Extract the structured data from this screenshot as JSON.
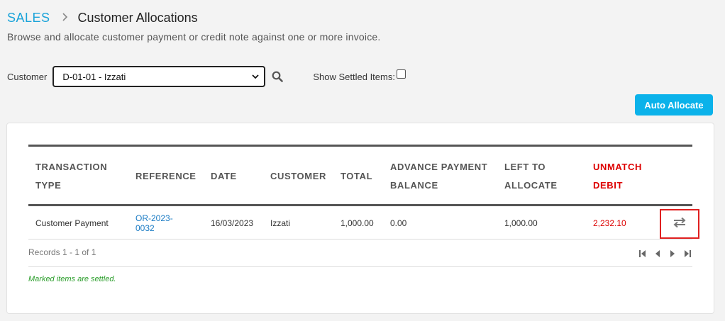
{
  "breadcrumb": {
    "section": "SALES",
    "separator": ">",
    "current": "Customer Allocations"
  },
  "subtitle": "Browse and allocate customer payment or credit note against one or more invoice.",
  "filters": {
    "customer_label": "Customer",
    "customer_selected": "D-01-01 - Izzati",
    "show_settled_label": "Show Settled Items:",
    "show_settled_checked": false
  },
  "toolbar": {
    "auto_allocate_label": "Auto Allocate"
  },
  "table": {
    "headers": {
      "transaction_type": [
        "TRANSACTION",
        "TYPE"
      ],
      "reference": "REFERENCE",
      "date": "DATE",
      "customer": "CUSTOMER",
      "total": "TOTAL",
      "advance_payment_balance": [
        "ADVANCE PAYMENT",
        "BALANCE"
      ],
      "left_to_allocate": [
        "LEFT TO",
        "ALLOCATE"
      ],
      "unmatch_debit": [
        "UNMATCH",
        "DEBIT"
      ]
    },
    "rows": [
      {
        "transaction_type": "Customer Payment",
        "reference": [
          "OR-2023-",
          "0032"
        ],
        "date": "16/03/2023",
        "customer": "Izzati",
        "total": "1,000.00",
        "advance_payment_balance": "0.00",
        "left_to_allocate": "1,000.00",
        "unmatch_debit": "2,232.10"
      }
    ]
  },
  "footer": {
    "records_text": "Records 1 - 1 of 1",
    "settled_note": "Marked items are settled."
  },
  "icons": {
    "breadcrumb_separator": "chevron-right-icon",
    "select_arrow": "chevron-down-icon",
    "search": "search-icon",
    "row_action": "swap-arrows-icon",
    "pager": [
      "first-page-icon",
      "prev-page-icon",
      "next-page-icon",
      "last-page-icon"
    ]
  },
  "colors": {
    "accent": "#1aa3d9",
    "button": "#0bb2ea",
    "link": "#1a7bc4",
    "unmatch": "#dd0000",
    "note": "#2a9d2a",
    "highlight_border": "#e02020"
  }
}
